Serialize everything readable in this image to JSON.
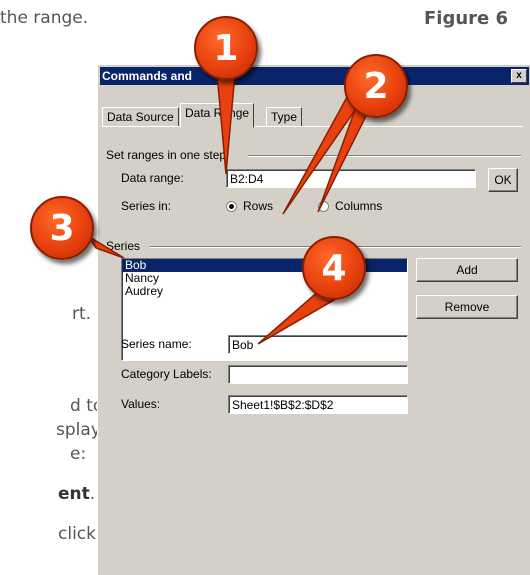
{
  "doc": {
    "line1": "the range.",
    "figure": "Figure 6",
    "line2": "rt.",
    "line3": "d to",
    "line4": "splay",
    "line5": "e:",
    "line6_bold": "ent",
    "line6_tail": ".",
    "line7": "click"
  },
  "dialog": {
    "title": "Commands and",
    "close_glyph": "x",
    "tabs": [
      {
        "label": "Data Source"
      },
      {
        "label": "Data Range"
      },
      {
        "label": "Type"
      }
    ],
    "set_ranges_group": "Set ranges in one step",
    "data_range_label": "Data range:",
    "data_range_value": "B2:D4",
    "ok_label": "OK",
    "series_in_label": "Series in:",
    "rows_label": "Rows",
    "columns_label": "Columns",
    "series_in_selected": "Rows",
    "series_group": "Series",
    "series_items": [
      "Bob",
      "Nancy",
      "Audrey"
    ],
    "selected_series": "Bob",
    "add_label": "Add",
    "remove_label": "Remove",
    "series_name_label": "Series name:",
    "series_name_value": "Bob",
    "category_labels_label": "Category Labels:",
    "category_labels_value": "",
    "values_label": "Values:",
    "values_value": "Sheet1!$B$2:$D$2"
  },
  "callouts": [
    "1",
    "2",
    "3",
    "4"
  ],
  "colors": {
    "callout": "#e8400e",
    "titlebar": "#0a246a",
    "dialog_bg": "#d4d0c8"
  }
}
